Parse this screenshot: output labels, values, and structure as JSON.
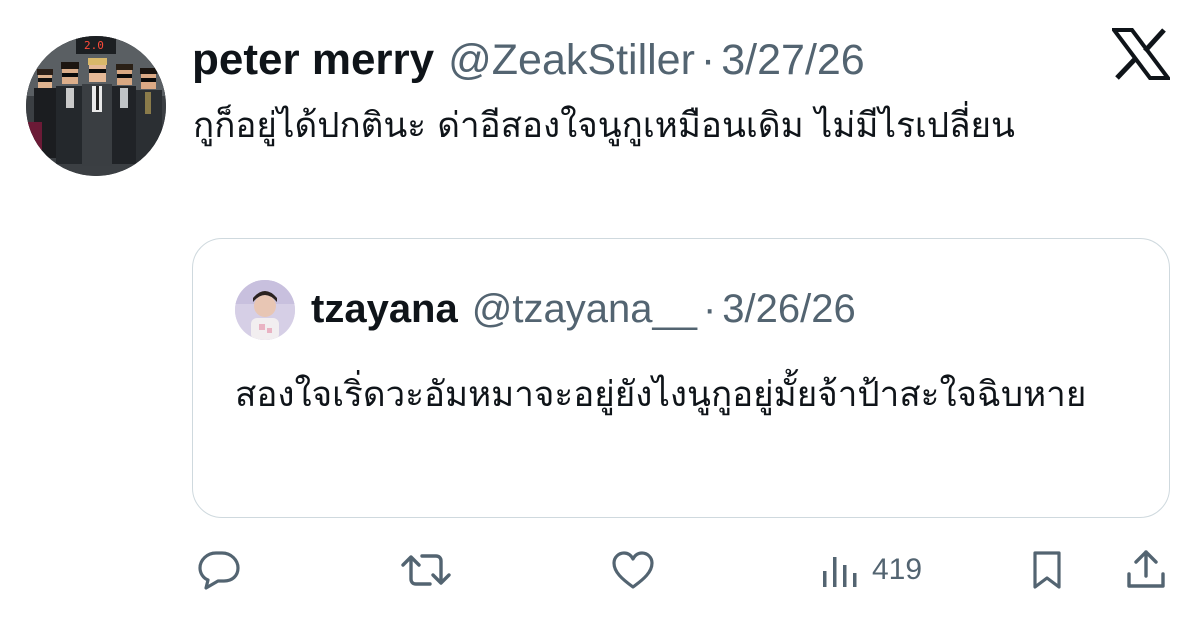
{
  "tweet": {
    "author_name": "peter merry",
    "author_handle": "@ZeakStiller",
    "separator": "·",
    "date": "3/27/26",
    "text": "กูก็อยู่ได้ปกตินะ ด่าอีสองใจนูกูเหมือนเดิม ไม่มีไรเปลี่ยน",
    "avatar_sign": "2.0"
  },
  "quote": {
    "author_name": "tzayana",
    "author_handle": "@tzayana__",
    "separator": "·",
    "date": "3/26/26",
    "text": "สองใจเริ่ดวะอัมหมาจะอยู่ยังไงนูกูอยู่มั้ยจ้าป้าสะใจฉิบหาย"
  },
  "actions": {
    "reply_icon": "reply-icon",
    "retweet_icon": "retweet-icon",
    "like_icon": "heart-icon",
    "views_icon": "views-icon",
    "views_count": "419",
    "bookmark_icon": "bookmark-icon",
    "share_icon": "share-icon"
  },
  "brand": {
    "logo": "x-logo",
    "text_color": "#0f1419",
    "muted_color": "#536471",
    "border_color": "#cfd9de"
  }
}
